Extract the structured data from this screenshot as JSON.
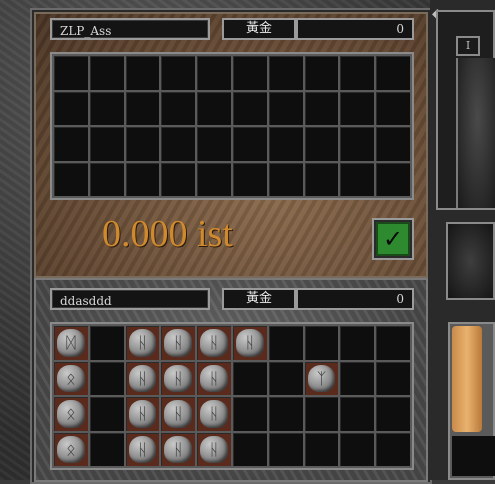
{
  "trade_window": {
    "top_panel": {
      "player_name": "ZLP_Ass",
      "gold_label": "黃金",
      "gold_amount": "0",
      "weight_text": "0.000 ist",
      "grid_cols": 10,
      "grid_rows": 4
    },
    "bottom_panel": {
      "player_name": "ddasddd",
      "gold_label": "黃金",
      "gold_amount": "0",
      "grid_cols": 10,
      "grid_rows": 4
    },
    "accept_icon": "checkmark-icon",
    "accept_glyph": "✓"
  },
  "side_panel": {
    "tab_marker": "I",
    "ornament": "◆"
  },
  "colors": {
    "weight_text": "#d08a2e",
    "accept_green": "#2e8a2e",
    "filled_slot": "#5a2a1c"
  }
}
